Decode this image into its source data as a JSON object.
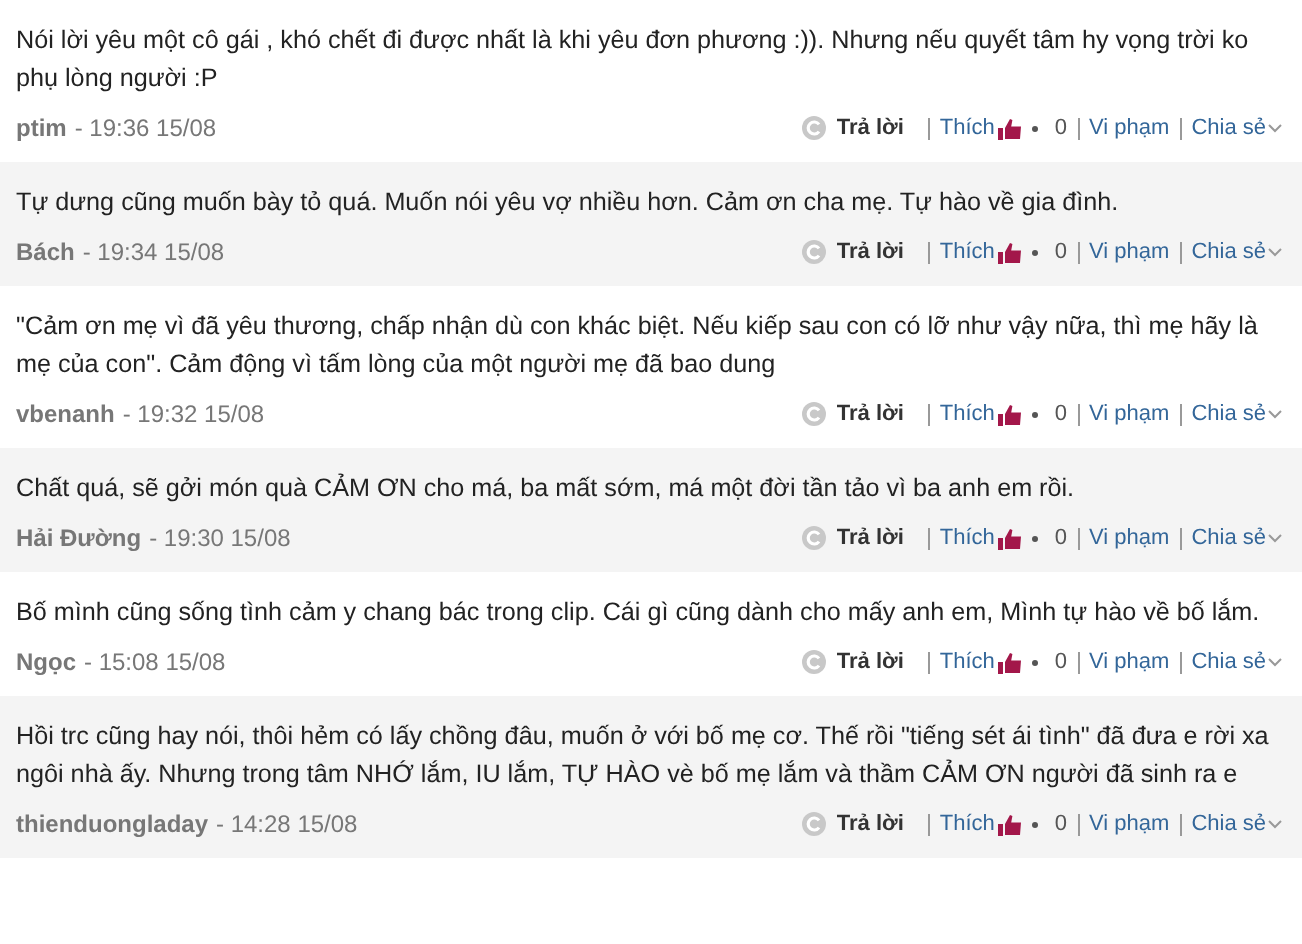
{
  "comments": [
    {
      "text": "Nói lời yêu một cô gái , khó chết đi được nhất là khi yêu đơn phương :)). Nhưng nếu quyết tâm hy vọng trời ko phụ lòng người :P",
      "author": "ptim",
      "time": "- 19:36 15/08",
      "actions": {
        "reply": "Trả lời",
        "like": "Thích",
        "like_count": "0",
        "report": "Vi phạm",
        "share": "Chia sẻ"
      }
    },
    {
      "text": "Tự dưng cũng muốn bày tỏ quá. Muốn nói yêu vợ nhiều hơn. Cảm ơn cha mẹ. Tự hào về gia đình.",
      "author": "Bách",
      "time": "- 19:34 15/08",
      "actions": {
        "reply": "Trả lời",
        "like": "Thích",
        "like_count": "0",
        "report": "Vi phạm",
        "share": "Chia sẻ"
      }
    },
    {
      "text": "\"Cảm ơn mẹ vì đã yêu thương, chấp nhận dù con khác biệt. Nếu kiếp sau con có lỡ như vậy nữa, thì mẹ hãy là mẹ của con\". Cảm động vì tấm lòng của một người mẹ đã bao dung",
      "author": "vbenanh",
      "time": "- 19:32 15/08",
      "actions": {
        "reply": "Trả lời",
        "like": "Thích",
        "like_count": "0",
        "report": "Vi phạm",
        "share": "Chia sẻ"
      }
    },
    {
      "text": "Chất quá, sẽ gởi món quà CẢM ƠN cho má, ba mất sớm, má một đời tần tảo vì ba anh em rồi.",
      "author": "Hải Đường",
      "time": "- 19:30 15/08",
      "actions": {
        "reply": "Trả lời",
        "like": "Thích",
        "like_count": "0",
        "report": "Vi phạm",
        "share": "Chia sẻ"
      }
    },
    {
      "text": "Bố mình cũng sống tình cảm y chang bác trong clip. Cái gì cũng dành cho mấy anh em, Mình tự hào về bố lắm.",
      "author": "Ngọc",
      "time": "- 15:08 15/08",
      "actions": {
        "reply": "Trả lời",
        "like": "Thích",
        "like_count": "0",
        "report": "Vi phạm",
        "share": "Chia sẻ"
      }
    },
    {
      "text": "Hồi trc cũng hay nói, thôi hẻm có lấy chồng đâu, muốn ở với bố mẹ cơ. Thế rồi \"tiếng sét ái tình\" đã đưa e rời xa ngôi nhà ấy. Nhưng trong tâm NHỚ lắm, IU lắm, TỰ HÀO vè bố mẹ lắm và thầm CẢM ƠN người đã sinh ra e",
      "author": "thienduongladay",
      "time": "- 14:28 15/08",
      "actions": {
        "reply": "Trả lời",
        "like": "Thích",
        "like_count": "0",
        "report": "Vi phạm",
        "share": "Chia sẻ"
      }
    }
  ]
}
